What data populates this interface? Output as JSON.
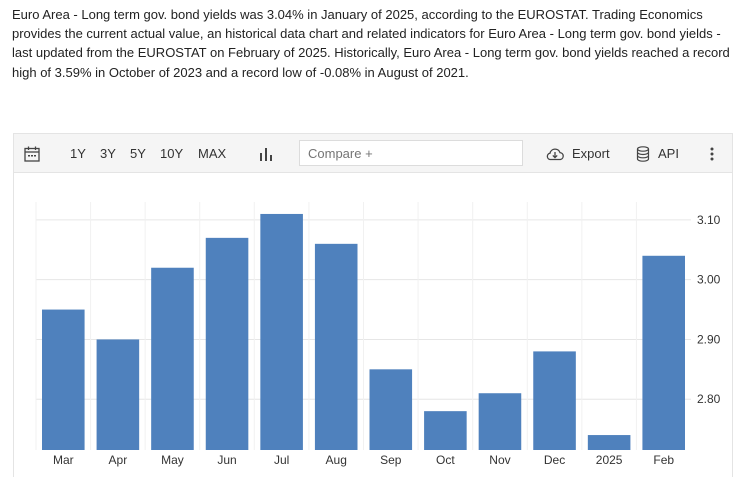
{
  "description": "Euro Area - Long term gov. bond yields was 3.04% in January of 2025, according to the EUROSTAT. Trading Economics provides the current actual value, an historical data chart and related indicators for Euro Area - Long term gov. bond yields - last updated from the EUROSTAT on February of 2025. Historically, Euro Area - Long term gov. bond yields reached a record high of 3.59% in October of 2023 and a record low of -0.08% in August of 2021.",
  "toolbar": {
    "ranges": [
      "1Y",
      "3Y",
      "5Y",
      "10Y",
      "MAX"
    ],
    "compare_placeholder": "Compare +",
    "export_label": "Export",
    "api_label": "API"
  },
  "colors": {
    "bar": "#4f81bd",
    "grid": "#e6e6e6",
    "toolbar_bg": "#f5f5f5"
  },
  "chart_data": {
    "type": "bar",
    "categories": [
      "Mar",
      "Apr",
      "May",
      "Jun",
      "Jul",
      "Aug",
      "Sep",
      "Oct",
      "Nov",
      "Dec",
      "2025",
      "Feb"
    ],
    "values": [
      2.95,
      2.9,
      3.02,
      3.07,
      3.11,
      3.06,
      2.85,
      2.78,
      2.81,
      2.88,
      2.74,
      3.04
    ],
    "yticks": [
      2.8,
      2.9,
      3.0,
      3.1
    ],
    "ytick_labels": [
      "2.80",
      "2.90",
      "3.00",
      "3.10"
    ],
    "ylim": [
      2.715,
      3.13
    ],
    "y_axis_side": "right",
    "grid": true
  }
}
